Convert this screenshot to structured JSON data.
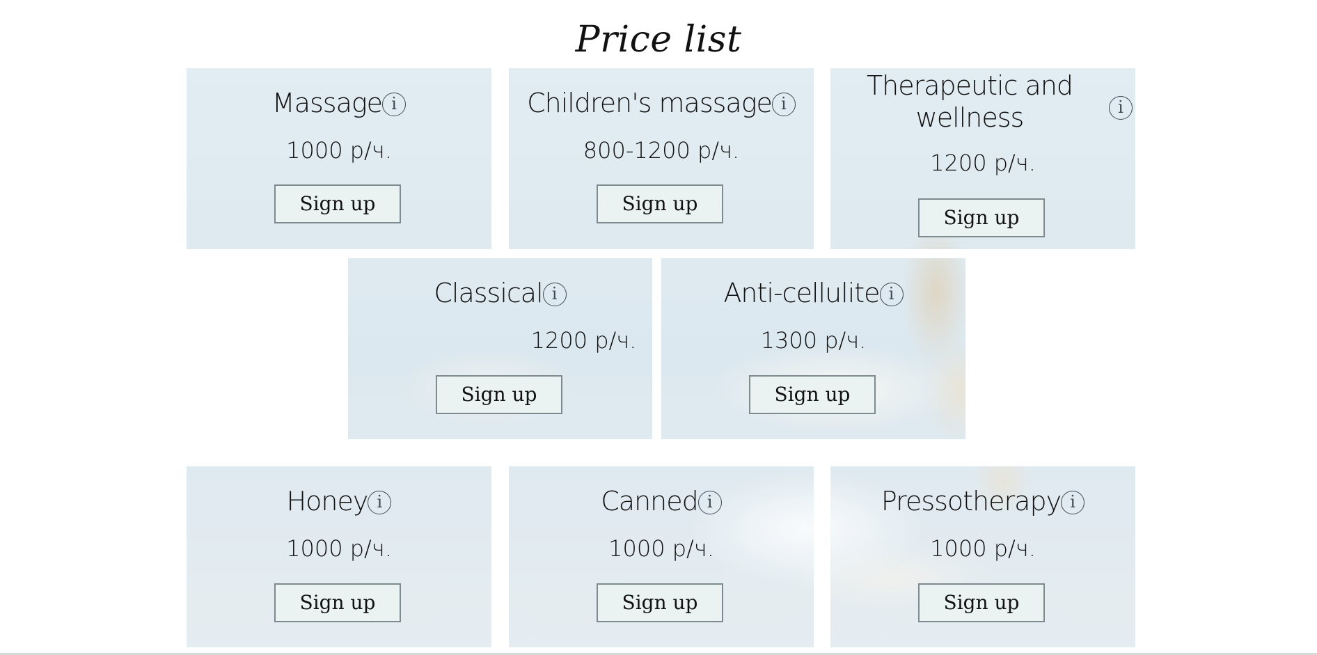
{
  "page": {
    "title": "Price list"
  },
  "cards": [
    {
      "title": "Massage",
      "price": "1000 р/ч.",
      "button": "Sign up",
      "info_icon": "info-icon"
    },
    {
      "title": "Children's massage",
      "price": "800-1200 р/ч.",
      "button": "Sign up",
      "info_icon": "info-icon"
    },
    {
      "title": "Therapeutic and wellness",
      "price": "1200 р/ч.",
      "button": "Sign up",
      "info_icon": "info-icon"
    },
    {
      "title": "Classical",
      "price": "1200 р/ч.",
      "button": "Sign up",
      "info_icon": "info-icon"
    },
    {
      "title": "Anti-cellulite",
      "price": "1300 р/ч.",
      "button": "Sign up",
      "info_icon": "info-icon"
    },
    {
      "title": "Honey",
      "price": "1000 р/ч.",
      "button": "Sign up",
      "info_icon": "info-icon"
    },
    {
      "title": "Canned",
      "price": "1000 р/ч.",
      "button": "Sign up",
      "info_icon": "info-icon"
    },
    {
      "title": "Pressotherapy",
      "price": "1000 р/ч.",
      "button": "Sign up",
      "info_icon": "info-icon"
    }
  ],
  "info_glyph": "i",
  "colors": {
    "page_background": "#ffffff",
    "card_tint": "#dfe9ef",
    "button_background": "#eaf3f1",
    "button_border": "#7d8a90",
    "text": "#111111"
  }
}
